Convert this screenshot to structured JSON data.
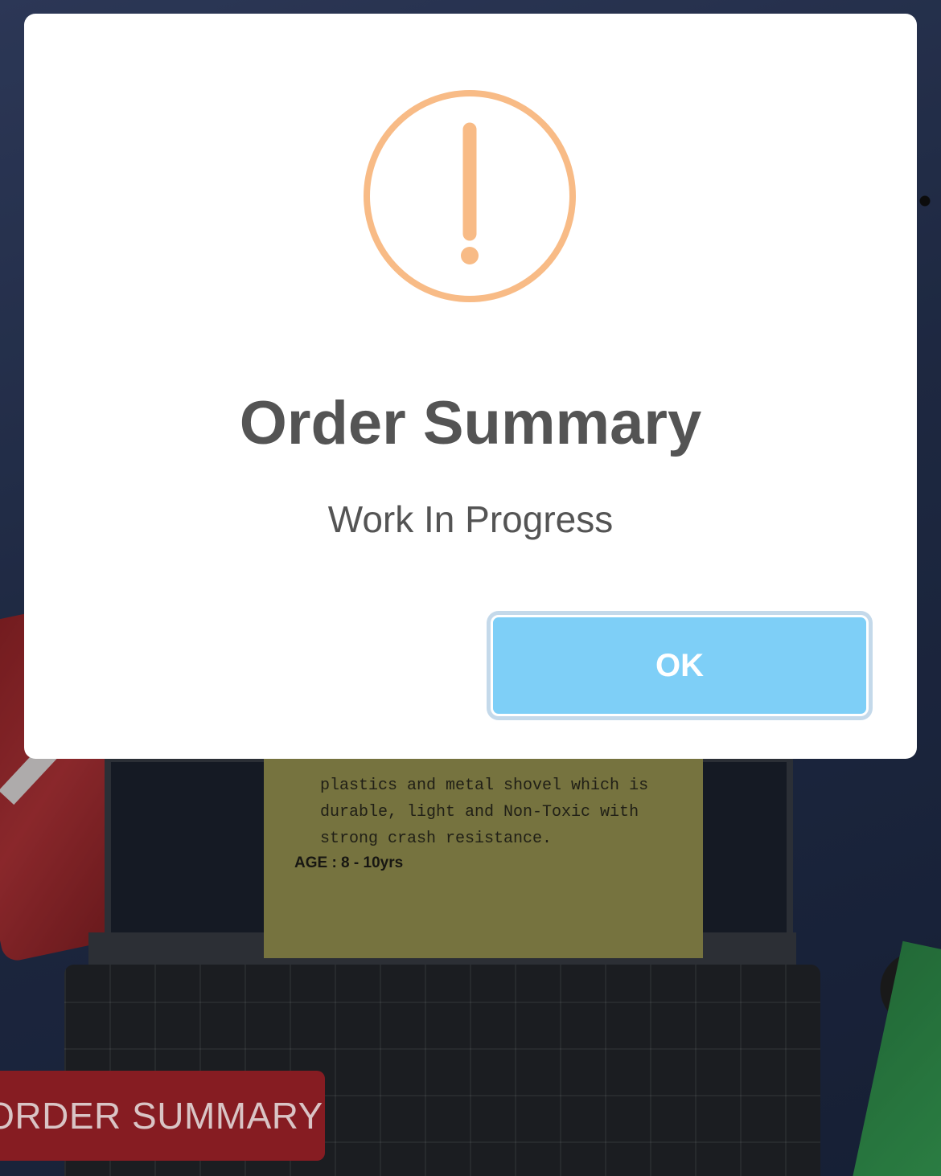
{
  "background": {
    "sticky_note_text": "plastics and metal shovel which is\ndurable, light and Non-Toxic with\nstrong crash resistance.",
    "sticky_note_age": "AGE : 8 - 10yrs"
  },
  "floating_button": {
    "label": "ORDER SUMMARY",
    "color": "#861c22"
  },
  "dialog": {
    "icon": "warning-icon",
    "icon_color": "#f8bb86",
    "title": "Order Summary",
    "text": "Work In Progress",
    "confirm_label": "OK",
    "confirm_color": "#7ecff7"
  }
}
